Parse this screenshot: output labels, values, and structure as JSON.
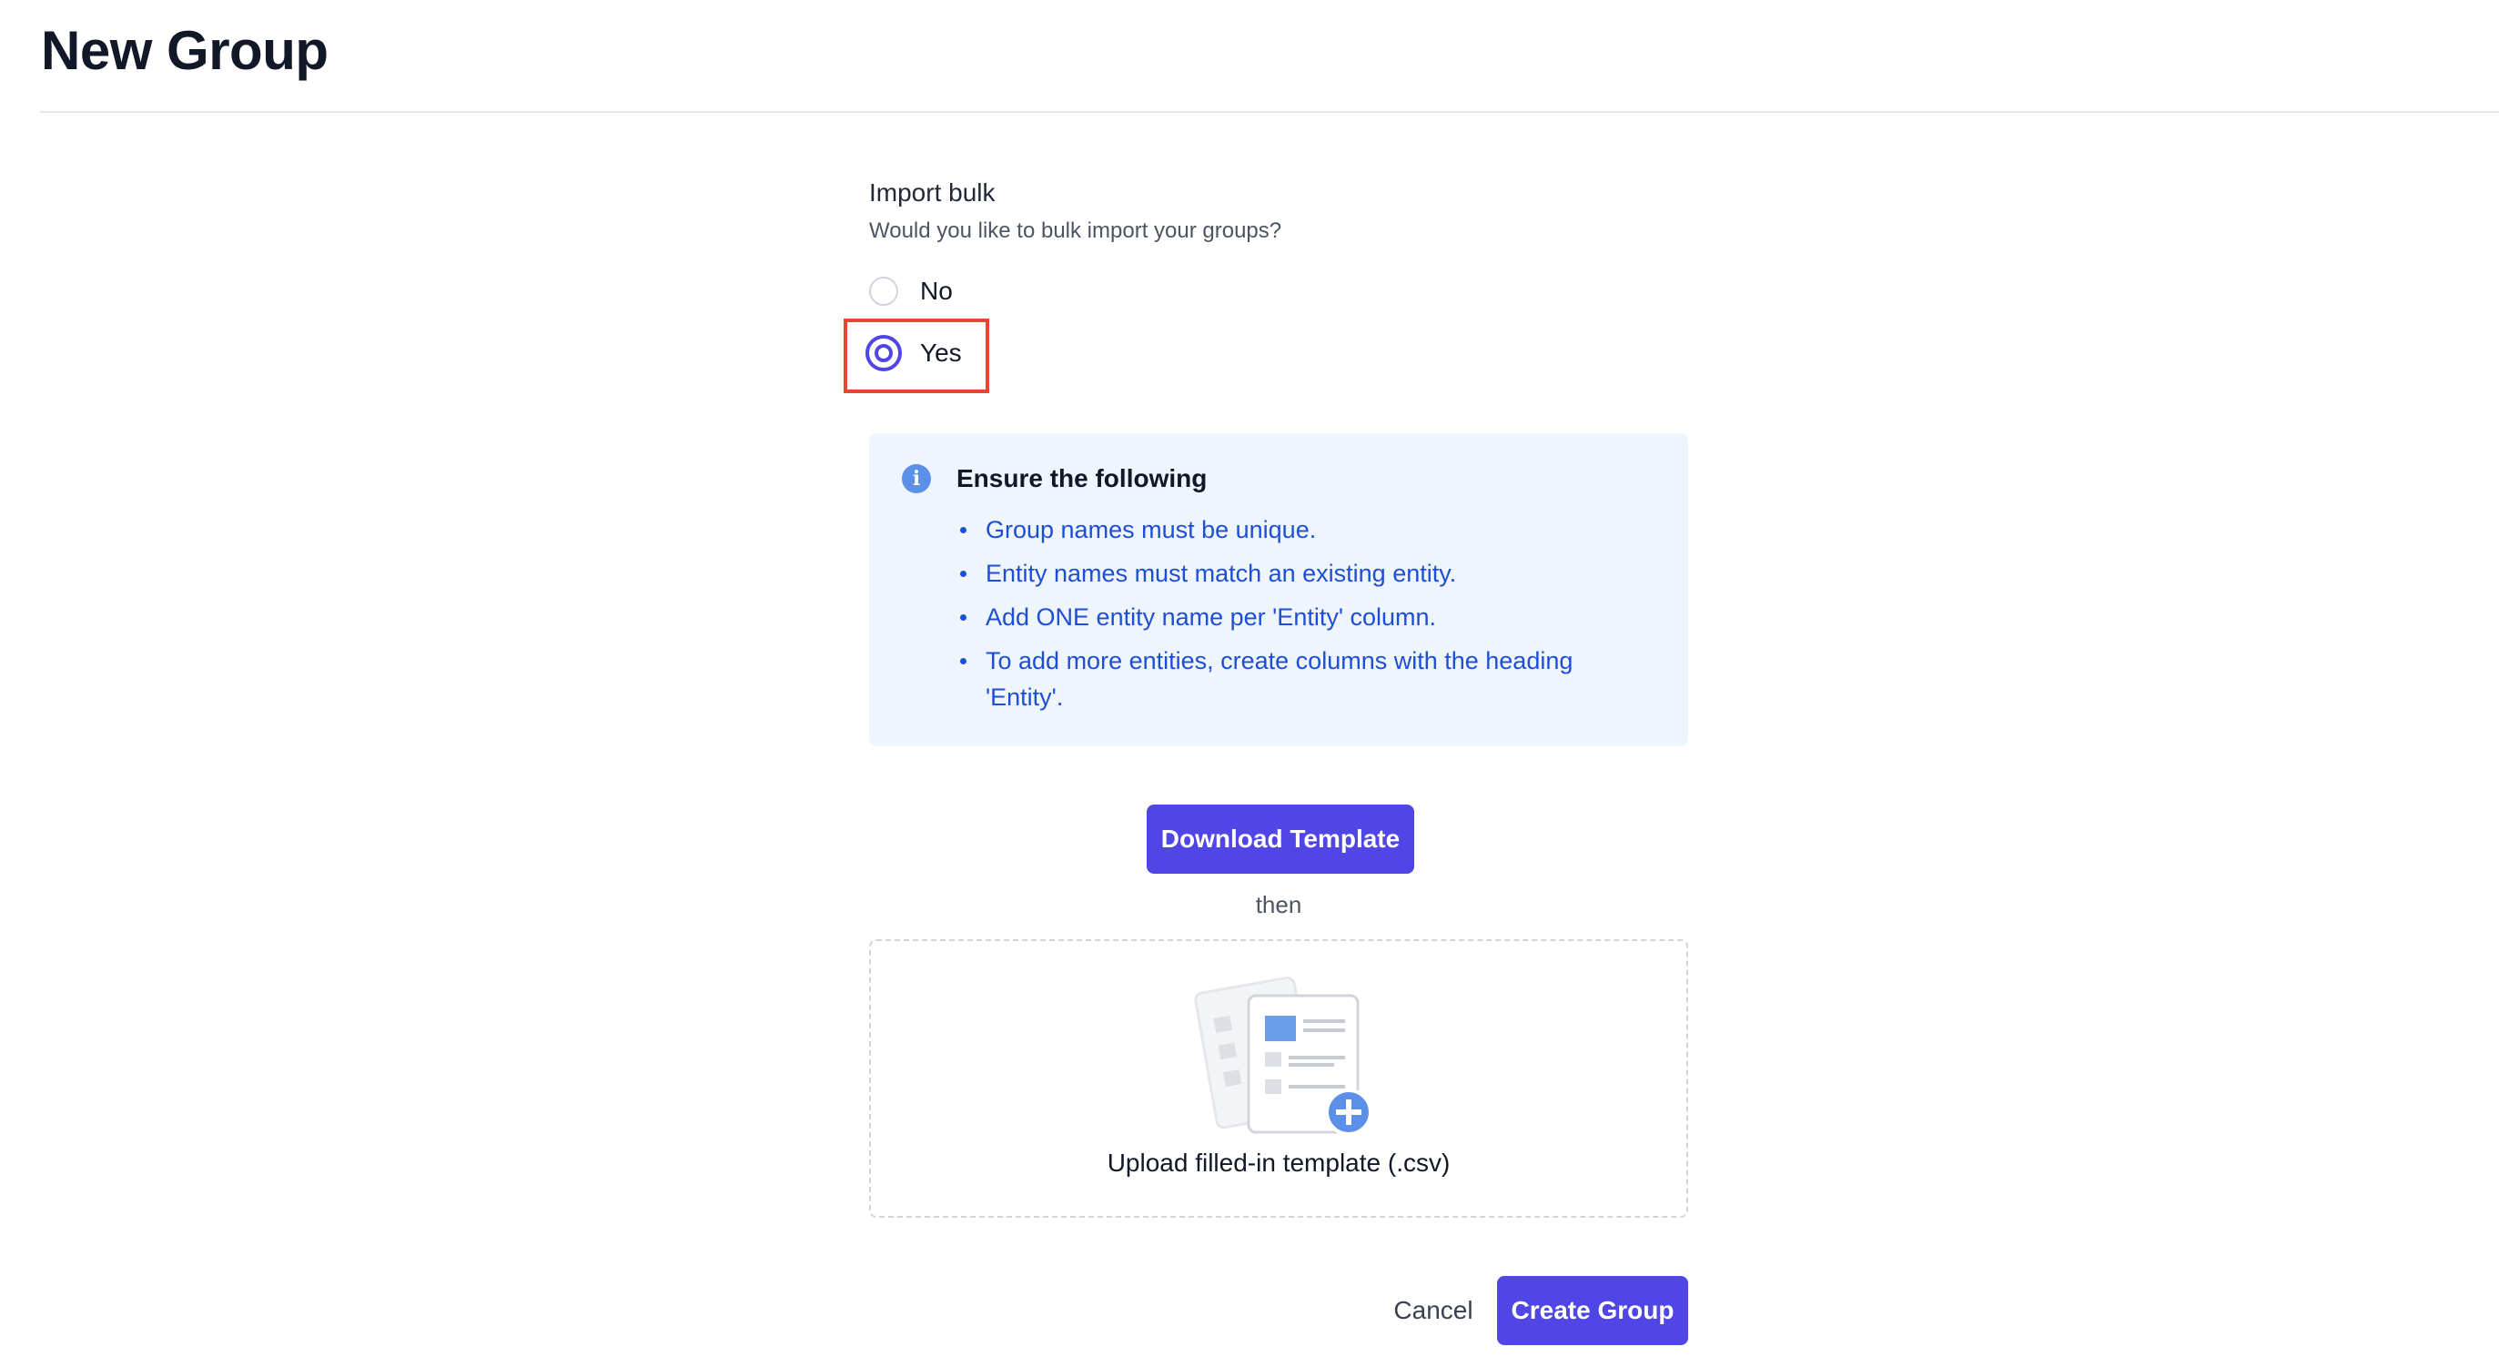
{
  "page": {
    "title": "New Group"
  },
  "import_bulk": {
    "label": "Import bulk",
    "help_text": "Would you like to bulk import your groups?",
    "options": [
      {
        "label": "No",
        "selected": false
      },
      {
        "label": "Yes",
        "selected": true
      }
    ]
  },
  "info": {
    "icon": "info-icon",
    "title": "Ensure the following",
    "items": [
      "Group names must be unique.",
      "Entity names must match an existing entity.",
      "Add ONE entity name per 'Entity' column.",
      "To add more entities, create columns with the heading 'Entity'."
    ]
  },
  "template": {
    "download_label": "Download Template",
    "then_text": "then",
    "upload_text": "Upload filled-in template (.csv)"
  },
  "actions": {
    "cancel_label": "Cancel",
    "create_label": "Create Group"
  },
  "colors": {
    "primary": "#4f46e5",
    "info_bg": "#eff5fd",
    "info_text": "#1d4ed8",
    "highlight": "#e5472f"
  }
}
